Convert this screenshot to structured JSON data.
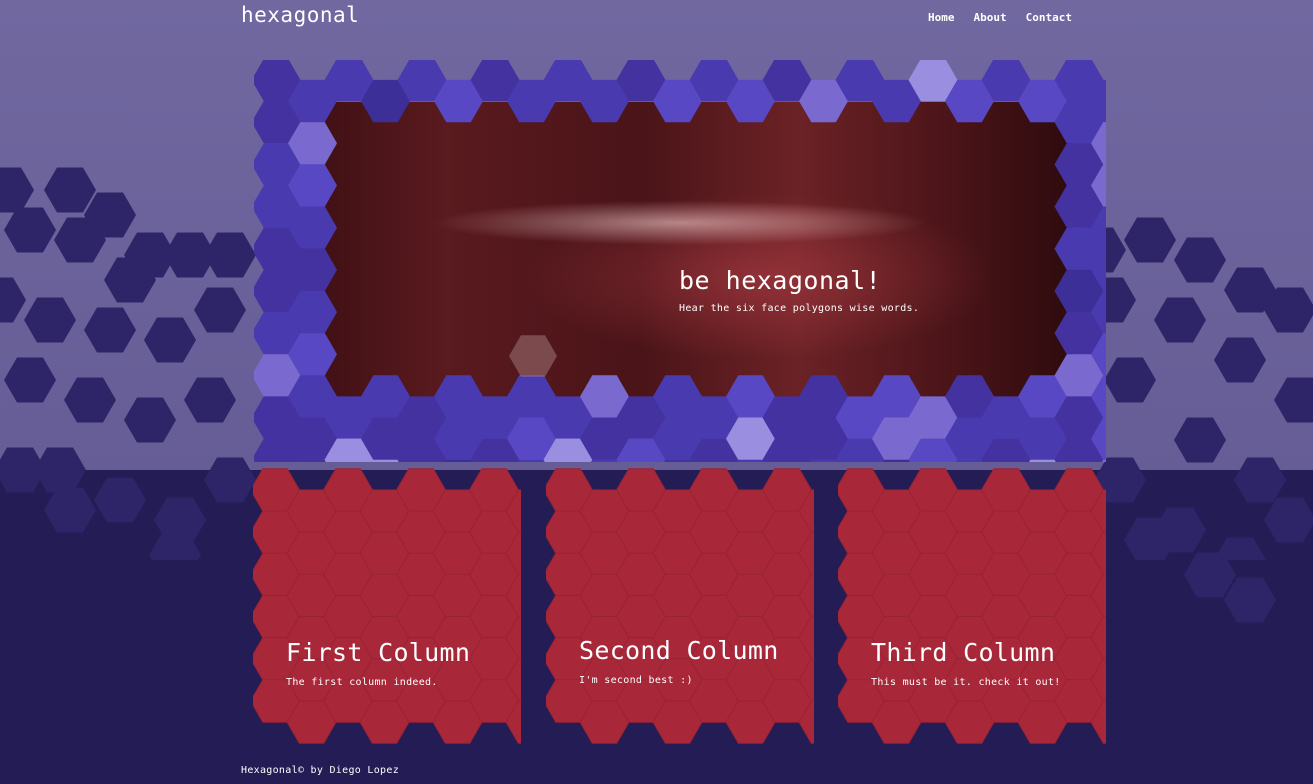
{
  "header": {
    "logo": "hexagonal",
    "nav": [
      {
        "label": "Home"
      },
      {
        "label": "About"
      },
      {
        "label": "Contact"
      }
    ]
  },
  "hero": {
    "title": "be hexagonal!",
    "subtitle": "Hear the six face polygons wise words."
  },
  "columns": [
    {
      "title": "First Column",
      "text": "The first column indeed."
    },
    {
      "title": "Second Column",
      "text": "I'm second best :)"
    },
    {
      "title": "Third Column",
      "text": "This must be it. check it out!"
    }
  ],
  "footer": {
    "text": "Hexagonal© by Diego Lopez"
  },
  "colors": {
    "page_top": "#7168a0",
    "page_bottom": "#231c55",
    "hex_purple": "#4a3ab0",
    "hex_red": "#a8283a",
    "text": "#ffffff"
  }
}
